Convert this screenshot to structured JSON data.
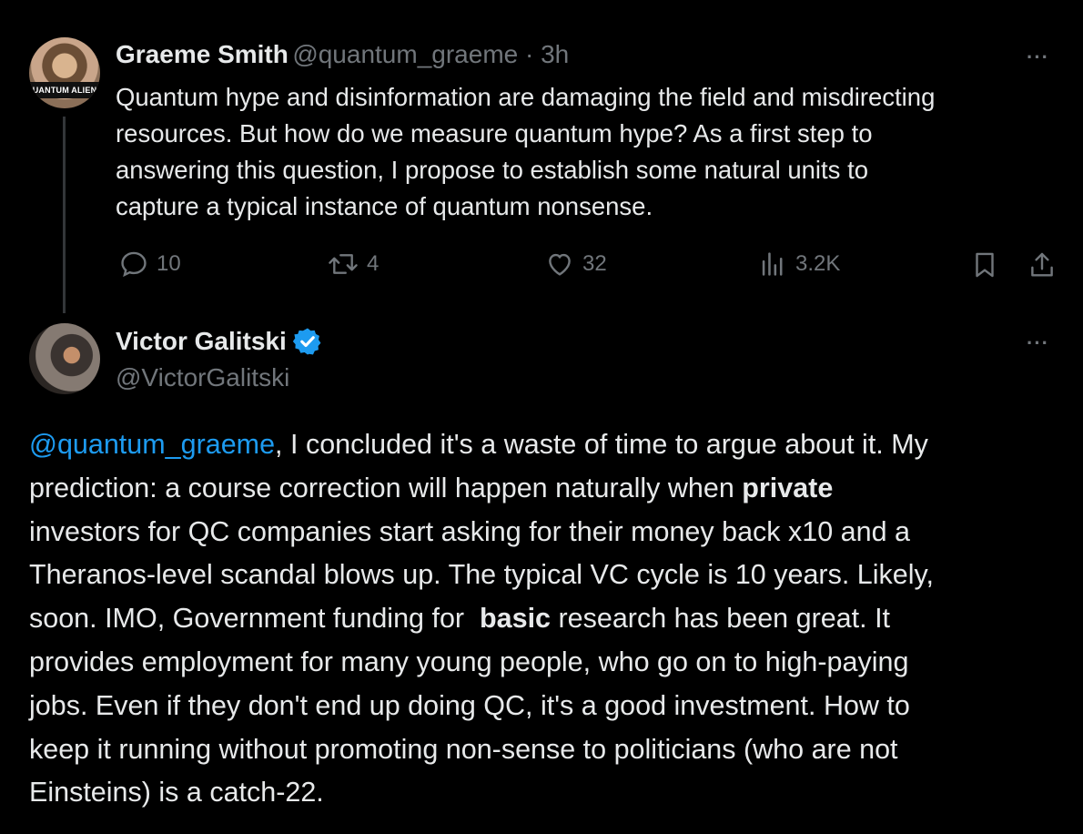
{
  "tweet1": {
    "author_name": "Graeme Smith",
    "handle_time": "@quantum_graeme · 3h",
    "avatar_text": "UANTUM ALIEN",
    "lines": [
      "Quantum hype and disinformation are damaging the field and misdirecting",
      "resources.  But how do we measure quantum hype?  As a first step to",
      "answering this question, I propose to establish some natural units to",
      "capture a typical instance of quantum nonsense."
    ],
    "more": "···",
    "actions": {
      "replies": "10",
      "reposts": "4",
      "likes": "32",
      "views": "3.2K"
    }
  },
  "tweet2": {
    "author_name": "Victor Galitski",
    "handle": "@VictorGalitski",
    "more": "···",
    "mention": "@quantum_graeme",
    "line1_rest": ", I concluded it's a waste of time to argue about it. My",
    "line2_pre": "prediction: a course correction will happen naturally when ",
    "line2_bold": "private",
    "line3": "investors for QC companies start asking for their money back x10 and a",
    "line4": "Theranos-level scandal blows up. The typical VC cycle is 10 years. Likely,",
    "line5_pre": "soon. IMO, Government funding for  ",
    "line5_bold": "basic",
    "line5_post": " research has been great. It",
    "line6": "provides employment for many young people, who go on to high-paying",
    "line7": "jobs. Even if they don't end up doing QC, it's a good investment. How to",
    "line8": "keep it running without promoting non-sense to politicians (who are not",
    "line9": "Einsteins) is a catch-22."
  },
  "colors": {
    "background": "#000000",
    "text": "#e7e9ea",
    "muted": "#71767b",
    "link": "#1d9bf0",
    "verified": "#1d9bf0"
  },
  "icons": [
    "reply-icon",
    "repost-icon",
    "like-icon",
    "views-icon",
    "bookmark-icon",
    "share-icon",
    "verified-badge-icon",
    "more-icon"
  ]
}
